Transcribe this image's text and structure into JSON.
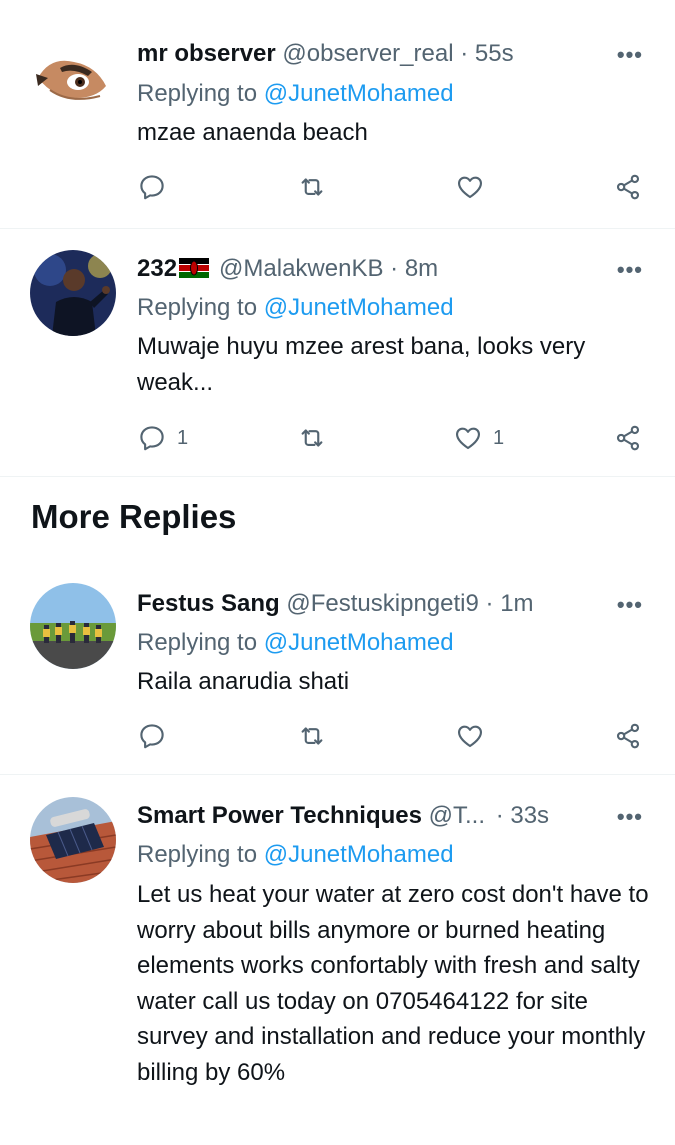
{
  "tweets": [
    {
      "name": "mr observer",
      "handle": "@observer_real",
      "time": "55s",
      "replying_prefix": "Replying to",
      "replying_to": "@JunetMohamed",
      "text": "mzae anaenda beach",
      "reply_count": "",
      "retweet_count": "",
      "like_count": ""
    },
    {
      "name": "232",
      "handle": "@MalakwenKB",
      "time": "8m",
      "replying_prefix": "Replying to",
      "replying_to": "@JunetMohamed",
      "text": "Muwaje huyu mzee arest bana, looks very weak...",
      "reply_count": "1",
      "retweet_count": "",
      "like_count": "1"
    }
  ],
  "more_replies": {
    "title": "More Replies",
    "tweets": [
      {
        "name": "Festus Sang",
        "handle": "@Festuskipngeti9",
        "time": "1m",
        "replying_prefix": "Replying to",
        "replying_to": "@JunetMohamed",
        "text": "Raila anarudia shati"
      },
      {
        "name": "Smart Power Techniques",
        "handle": "@T...",
        "time": "33s",
        "replying_prefix": "Replying to",
        "replying_to": "@JunetMohamed",
        "text": "Let us heat your water at zero cost don't have to worry about bills anymore or burned heating elements works confortably with fresh and salty water call us today on 0705464122 for site survey and installation and reduce your monthly billing by 60%"
      }
    ]
  },
  "ui": {
    "dot": "·",
    "more_glyph": "•••"
  },
  "icons": {
    "reply": "reply-icon",
    "retweet": "retweet-icon",
    "like": "heart-icon",
    "share": "share-icon",
    "more": "more-options-icon",
    "flag": "kenya-flag-icon"
  },
  "colors": {
    "accent": "#1d9bf0",
    "secondary_text": "#536471",
    "primary_text": "#0f1419",
    "divider": "#eff3f4"
  }
}
